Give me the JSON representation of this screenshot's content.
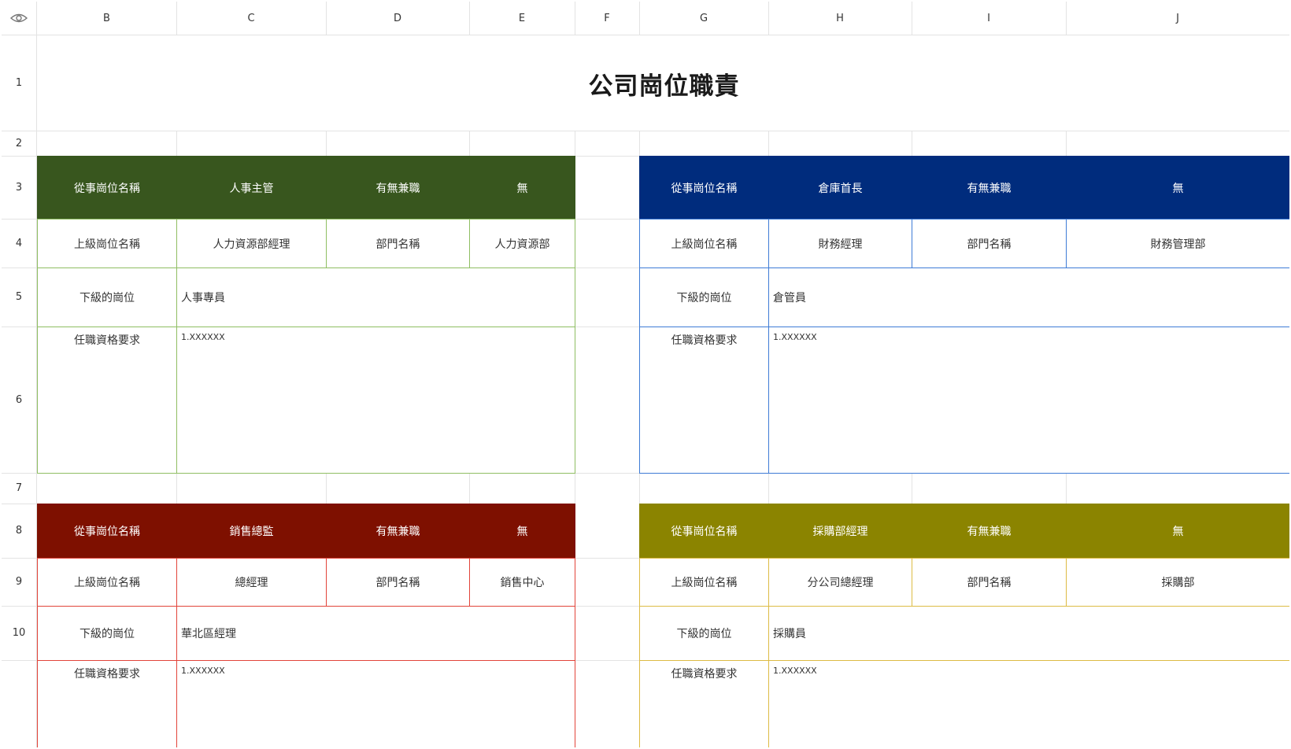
{
  "columns": [
    "B",
    "C",
    "D",
    "E",
    "F",
    "G",
    "H",
    "I",
    "J"
  ],
  "rows": [
    "1",
    "2",
    "3",
    "4",
    "5",
    "6",
    "7",
    "8",
    "9",
    "10"
  ],
  "title": "公司崗位職責",
  "colors": {
    "green_head": "#38561E",
    "green_border": "#8FBE62",
    "blue_head": "#002C7D",
    "blue_border": "#3E7BD6",
    "red_head": "#7E1000",
    "red_border": "#E2443A",
    "olive_head": "#8B8400",
    "olive_border": "#DDBB44"
  },
  "blocks": [
    {
      "header": [
        "從事崗位名稱",
        "人事主管",
        "有無兼職",
        "無"
      ],
      "row2": [
        "上級崗位名稱",
        "人力資源部經理",
        "部門名稱",
        "人力資源部"
      ],
      "sub_label": "下級的崗位",
      "sub_value": "人事專員",
      "req_label": "任職資格要求",
      "req_value": "1.XXXXXX"
    },
    {
      "header": [
        "從事崗位名稱",
        "倉庫首長",
        "有無兼職",
        "無"
      ],
      "row2": [
        "上級崗位名稱",
        "財務經理",
        "部門名稱",
        "財務管理部"
      ],
      "sub_label": "下級的崗位",
      "sub_value": "倉管員",
      "req_label": "任職資格要求",
      "req_value": "1.XXXXXX"
    },
    {
      "header": [
        "從事崗位名稱",
        "銷售總監",
        "有無兼職",
        "無"
      ],
      "row2": [
        "上級崗位名稱",
        "總經理",
        "部門名稱",
        "銷售中心"
      ],
      "sub_label": "下級的崗位",
      "sub_value": "華北區經理",
      "req_label": "任職資格要求",
      "req_value": "1.XXXXXX"
    },
    {
      "header": [
        "從事崗位名稱",
        "採購部經理",
        "有無兼職",
        "無"
      ],
      "row2": [
        "上級崗位名稱",
        "分公司總經理",
        "部門名稱",
        "採購部"
      ],
      "sub_label": "下級的崗位",
      "sub_value": "採購員",
      "req_label": "任職資格要求",
      "req_value": "1.XXXXXX"
    }
  ]
}
